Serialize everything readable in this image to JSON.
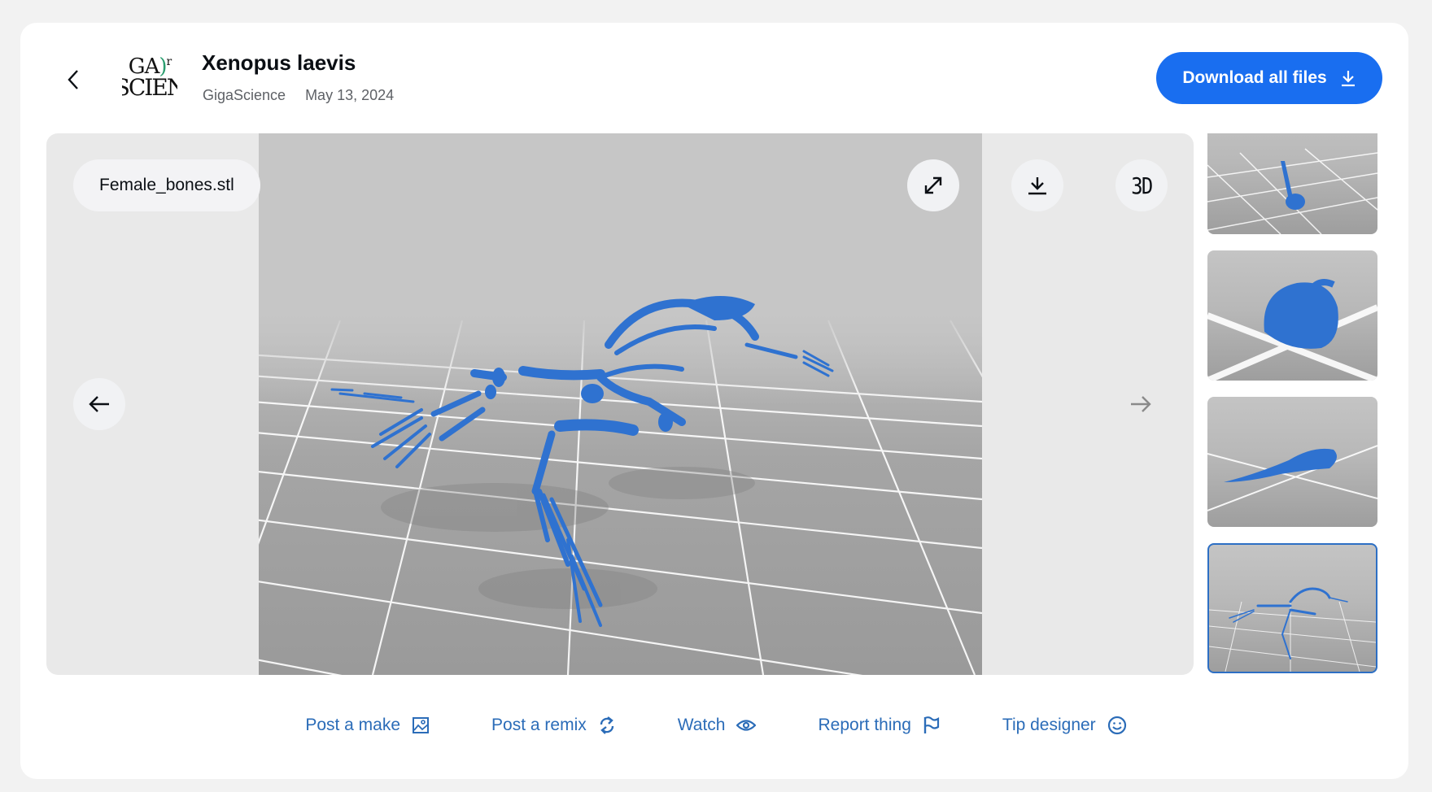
{
  "header": {
    "back_icon": "chevron-left-icon",
    "logo": {
      "line1": "GA",
      "paren": ")",
      "line1_tail": "r",
      "line2": "SCIEN",
      "name": "GigaScience logo"
    },
    "title": "Xenopus laevis",
    "author": "GigaScience",
    "date": "May 13, 2024",
    "download_all_label": "Download all files",
    "download_all_icon": "download-icon"
  },
  "viewer": {
    "file_name": "Female_bones.stl",
    "buttons": [
      {
        "name": "fullscreen",
        "icon": "expand-icon"
      },
      {
        "name": "download",
        "icon": "download-icon"
      },
      {
        "name": "view-3d",
        "label": "3D"
      }
    ],
    "prev_icon": "arrow-left-icon",
    "next_icon": "arrow-right-icon",
    "model_color": "#2f72d0"
  },
  "thumbnails": [
    {
      "label": "Skeleton model top view",
      "selected": false
    },
    {
      "label": "Organ model",
      "selected": false
    },
    {
      "label": "Elongated organ model",
      "selected": false
    },
    {
      "label": "Female_bones.stl",
      "selected": true
    }
  ],
  "actions": [
    {
      "label": "Post a make",
      "icon": "image-icon"
    },
    {
      "label": "Post a remix",
      "icon": "refresh-icon"
    },
    {
      "label": "Watch",
      "icon": "eye-icon"
    },
    {
      "label": "Report thing",
      "icon": "flag-icon"
    },
    {
      "label": "Tip designer",
      "icon": "smiley-icon"
    }
  ],
  "colors": {
    "accent": "#196ef0",
    "link": "#2b6cb8",
    "model": "#2f72d0"
  }
}
